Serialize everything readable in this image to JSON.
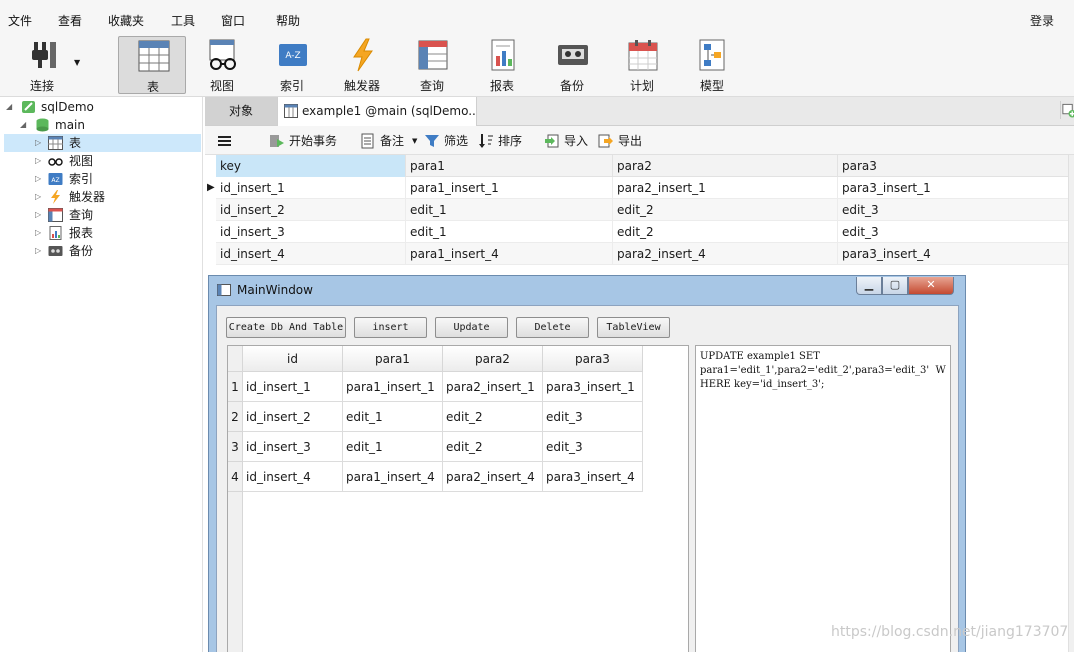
{
  "menu": {
    "items": [
      "文件",
      "查看",
      "收藏夹",
      "工具",
      "窗口",
      "帮助"
    ],
    "login": "登录"
  },
  "toolbar": {
    "connect": "连接",
    "table": "表",
    "view": "视图",
    "index": "索引",
    "trigger": "触发器",
    "query": "查询",
    "report": "报表",
    "backup": "备份",
    "schedule": "计划",
    "model": "模型",
    "active": "表"
  },
  "tree": {
    "root": "sqlDemo",
    "db": "main",
    "items": [
      "表",
      "视图",
      "索引",
      "触发器",
      "查询",
      "报表",
      "备份"
    ],
    "selected": "表"
  },
  "tabs": {
    "objects": "对象",
    "editor": "example1 @main (sqlDemo..."
  },
  "actions": {
    "menu_icon": "hamburger-icon",
    "begin": "开始事务",
    "note": "备注",
    "filter": "筛选",
    "sort": "排序",
    "import": "导入",
    "export": "导出"
  },
  "grid": {
    "columns": [
      "key",
      "para1",
      "para2",
      "para3"
    ],
    "rows": [
      [
        "id_insert_1",
        "para1_insert_1",
        "para2_insert_1",
        "para3_insert_1"
      ],
      [
        "id_insert_2",
        "edit_1",
        "edit_2",
        "edit_3"
      ],
      [
        "id_insert_3",
        "edit_1",
        "edit_2",
        "edit_3"
      ],
      [
        "id_insert_4",
        "para1_insert_4",
        "para2_insert_4",
        "para3_insert_4"
      ]
    ],
    "current_row": 1
  },
  "mainwindow": {
    "title": "MainWindow",
    "buttons": {
      "create": "Create Db And Table",
      "insert": "insert",
      "update": "Update",
      "delete": "Delete",
      "tableview": "TableView"
    },
    "table": {
      "headers": [
        "id",
        "para1",
        "para2",
        "para3"
      ],
      "row_numbers": [
        "1",
        "2",
        "3",
        "4"
      ],
      "rows": [
        [
          "id_insert_1",
          "para1_insert_1",
          "para2_insert_1",
          "para3_insert_1"
        ],
        [
          "id_insert_2",
          "edit_1",
          "edit_2",
          "edit_3"
        ],
        [
          "id_insert_3",
          "edit_1",
          "edit_2",
          "edit_3"
        ],
        [
          "id_insert_4",
          "para1_insert_4",
          "para2_insert_4",
          "para3_insert_4"
        ]
      ]
    },
    "sql": "UPDATE example1 SET\npara1='edit_1',para2='edit_2',para3='edit_3'  WHERE key='id_insert_3';"
  },
  "watermark": "https://blog.csdn.net/jiang173707",
  "colors": {
    "selection": "#cde8fb",
    "window_frame": "#a7c6e5",
    "close_button": "#c44a31",
    "trigger_orange": "#f5a623"
  }
}
